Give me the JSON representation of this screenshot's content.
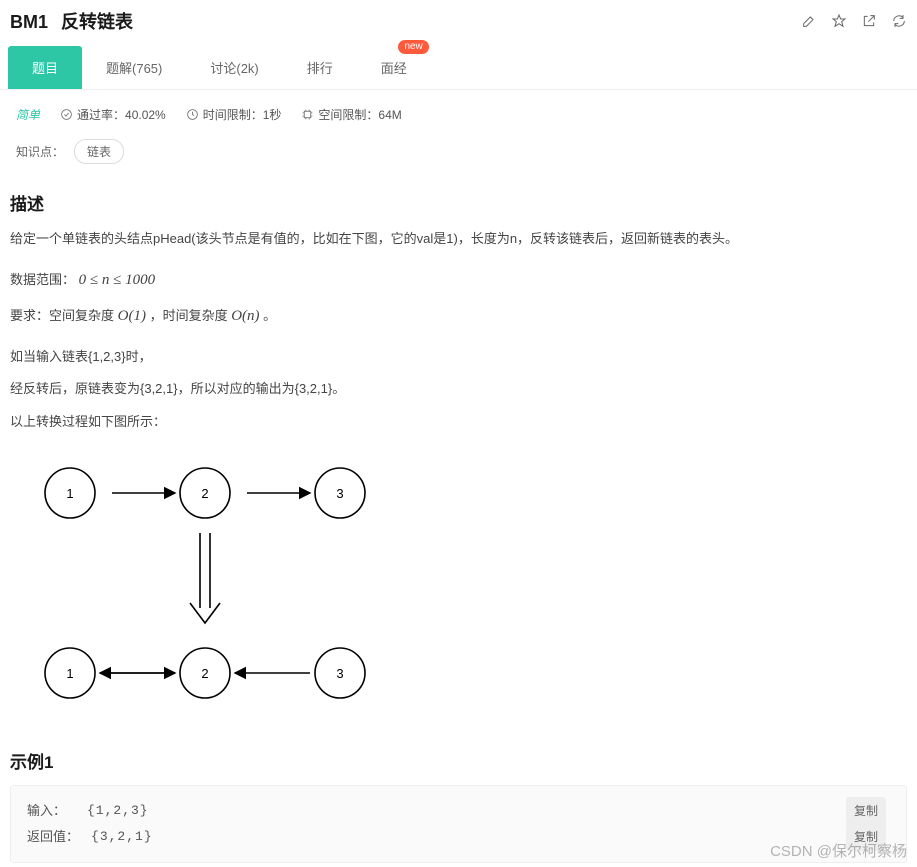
{
  "header": {
    "problem_id": "BM1",
    "problem_title": "反转链表"
  },
  "tabs": [
    {
      "label": "题目",
      "active": true
    },
    {
      "label": "题解(765)"
    },
    {
      "label": "讨论(2k)"
    },
    {
      "label": "排行"
    },
    {
      "label": "面经",
      "badge": "new"
    }
  ],
  "meta": {
    "difficulty": "简单",
    "pass_rate_label": "通过率：40.02%",
    "time_limit_label": "时间限制：1秒",
    "mem_limit_label": "空间限制：64M"
  },
  "tags": {
    "label": "知识点：",
    "items": [
      "链表"
    ]
  },
  "description": {
    "heading": "描述",
    "p1": "给定一个单链表的头结点pHead(该头节点是有值的，比如在下图，它的val是1)，长度为n，反转该链表后，返回新链表的表头。",
    "range_prefix": "数据范围：",
    "range_formula": "0 ≤ n ≤ 1000",
    "req_prefix": "要求：空间复杂度 ",
    "req_o1": "O(1)",
    "req_mid": " ，时间复杂度 ",
    "req_on": "O(n)",
    "req_suffix": " 。",
    "p3a": "如当输入链表{1,2,3}时，",
    "p3b": "经反转后，原链表变为{3,2,1}，所以对应的输出为{3,2,1}。",
    "p3c": "以上转换过程如下图所示："
  },
  "diagram": {
    "nodes_top": [
      "1",
      "2",
      "3"
    ],
    "nodes_bottom": [
      "1",
      "2",
      "3"
    ]
  },
  "example": {
    "heading": "示例1",
    "input_label": "输入：",
    "input_value": "{1,2,3}",
    "output_label": "返回值：",
    "output_value": "{3,2,1}",
    "copy_label": "复制"
  },
  "watermark": "CSDN @保尔柯察杨"
}
